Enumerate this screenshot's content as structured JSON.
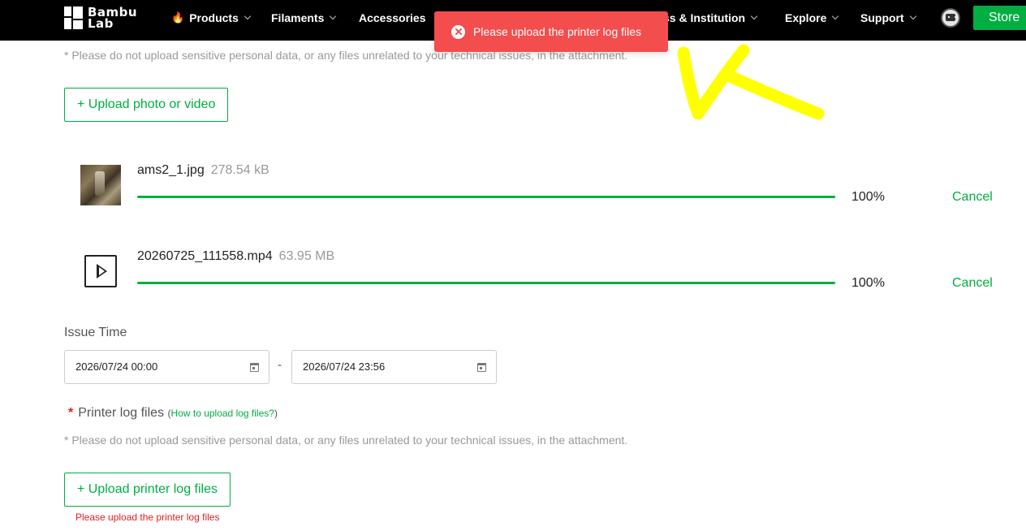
{
  "nav": {
    "logo_line1": "Bambu",
    "logo_line2": "Lab",
    "items": [
      {
        "label": "Products",
        "has_fire": true
      },
      {
        "label": "Filaments"
      },
      {
        "label": "Accessories"
      },
      {
        "label": "ss & Institution"
      },
      {
        "label": "Explore"
      },
      {
        "label": "Support"
      }
    ],
    "fire_icon": "🔥",
    "store_label": "Store"
  },
  "toast": {
    "message": "Please upload the printer log files",
    "icon": "error-circle-icon",
    "color": "#f44d4d"
  },
  "attachments": {
    "note": "* Please do not upload sensitive personal data, or any files unrelated to your technical issues, in the attachment.",
    "upload_label": "+ Upload photo or video",
    "files": [
      {
        "name": "ams2_1.jpg",
        "size": "278.54 kB",
        "percent_label": "100%",
        "progress": 1.0,
        "cancel": "Cancel",
        "kind": "image-thumbnail"
      },
      {
        "name": "20260725_111558.mp4",
        "size": "63.95 MB",
        "percent_label": "100%",
        "progress": 1.0,
        "cancel": "Cancel",
        "kind": "video-icon"
      }
    ]
  },
  "issue_time": {
    "label": "Issue Time",
    "start": "2026/07/24 00:00",
    "separator": "-",
    "end": "2026/07/24 23:56"
  },
  "log_files": {
    "required_mark": "*",
    "label": "Printer log files",
    "paren_open": "(",
    "help_link": "How to upload log files?",
    "paren_close": ")",
    "note": "* Please do not upload sensitive personal data, or any files unrelated to your technical issues, in the attachment.",
    "upload_label": "+ Upload printer log files",
    "error": "Please upload the printer log files"
  },
  "colors": {
    "accent": "#00ae42",
    "error": "#e02020",
    "nav_bg": "#000000",
    "annotation": "#ffff00"
  }
}
